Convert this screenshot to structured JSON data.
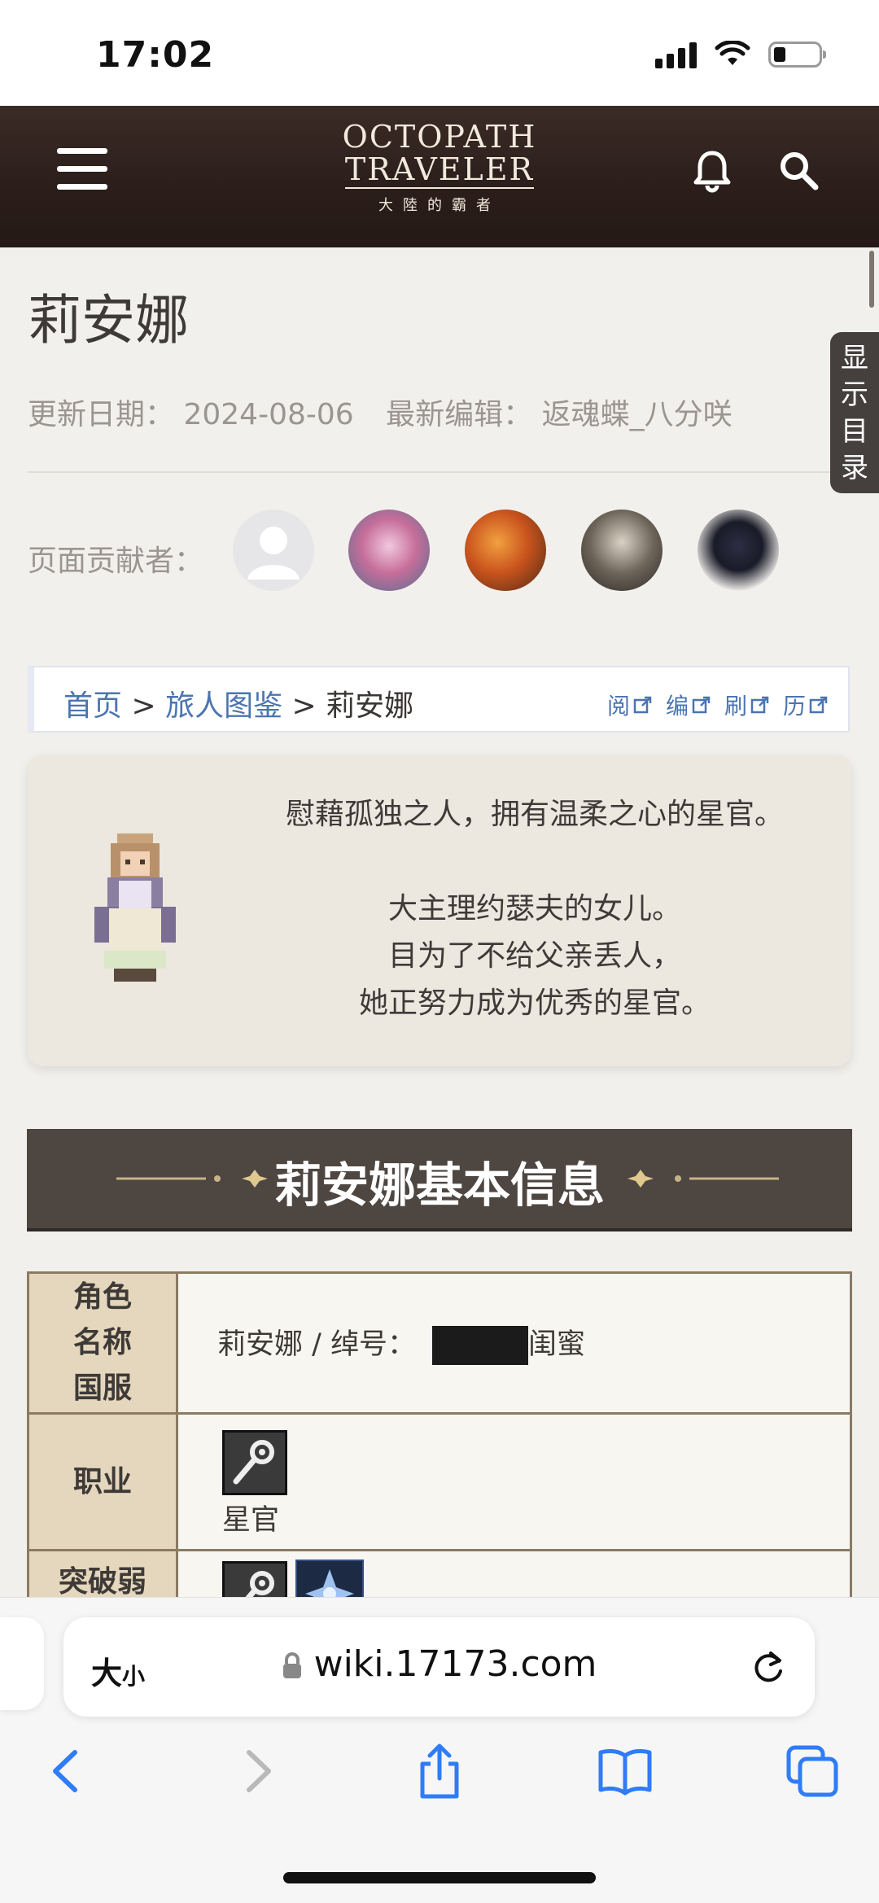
{
  "status_bar": {
    "time": "17:02"
  },
  "header": {
    "logo_line1": "OCTOPATH",
    "logo_line2": "TRAVELER",
    "logo_line3": "大陸的霸者"
  },
  "page": {
    "title": "莉安娜",
    "update_label": "更新日期：",
    "update_date": "2024-08-06",
    "editor_label": "最新编辑：",
    "editor_name": "返魂蝶_八分咲",
    "contributors_label": "页面贡献者："
  },
  "toc_tab": "显示目录",
  "breadcrumb": {
    "home": "首页",
    "sep1": " > ",
    "section": "旅人图鉴",
    "sep2": " > ",
    "current": "莉安娜",
    "actions": [
      "阅",
      "编",
      "刷",
      "历"
    ]
  },
  "intro": {
    "line1": "慰藉孤独之人，拥有温柔之心的星官。",
    "line2": "大主理约瑟夫的女儿。",
    "line3": "目为了不给父亲丢人，",
    "line4": "她正努力成为优秀的星官。"
  },
  "section": {
    "title": "莉安娜基本信息"
  },
  "info_table": {
    "row1_label": "角色名称国服",
    "row1_value_a": "莉安娜 / 绰号：",
    "row1_value_b": "闺蜜",
    "row2_label": "职业",
    "row2_value": "星官",
    "row3_label": "突破弱点"
  },
  "browser": {
    "text_size": "大",
    "text_size_small": "小",
    "url": "wiki.17173.com"
  },
  "colors": {
    "header_bg": "#2c1f1b",
    "link": "#4b74b0",
    "table_header": "#e5d7bd",
    "banner": "#4e4641"
  }
}
